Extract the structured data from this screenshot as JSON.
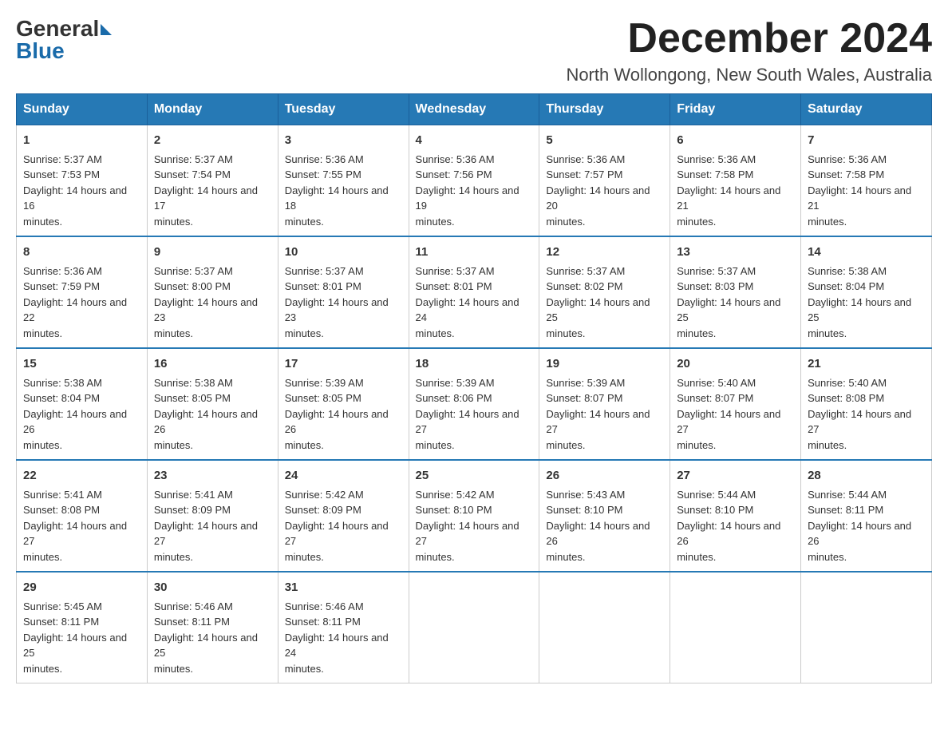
{
  "header": {
    "logo_general": "General",
    "logo_blue": "Blue",
    "month_title": "December 2024",
    "location": "North Wollongong, New South Wales, Australia"
  },
  "weekdays": [
    "Sunday",
    "Monday",
    "Tuesday",
    "Wednesday",
    "Thursday",
    "Friday",
    "Saturday"
  ],
  "weeks": [
    [
      {
        "day": "1",
        "sunrise": "5:37 AM",
        "sunset": "7:53 PM",
        "daylight": "14 hours and 16 minutes."
      },
      {
        "day": "2",
        "sunrise": "5:37 AM",
        "sunset": "7:54 PM",
        "daylight": "14 hours and 17 minutes."
      },
      {
        "day": "3",
        "sunrise": "5:36 AM",
        "sunset": "7:55 PM",
        "daylight": "14 hours and 18 minutes."
      },
      {
        "day": "4",
        "sunrise": "5:36 AM",
        "sunset": "7:56 PM",
        "daylight": "14 hours and 19 minutes."
      },
      {
        "day": "5",
        "sunrise": "5:36 AM",
        "sunset": "7:57 PM",
        "daylight": "14 hours and 20 minutes."
      },
      {
        "day": "6",
        "sunrise": "5:36 AM",
        "sunset": "7:58 PM",
        "daylight": "14 hours and 21 minutes."
      },
      {
        "day": "7",
        "sunrise": "5:36 AM",
        "sunset": "7:58 PM",
        "daylight": "14 hours and 21 minutes."
      }
    ],
    [
      {
        "day": "8",
        "sunrise": "5:36 AM",
        "sunset": "7:59 PM",
        "daylight": "14 hours and 22 minutes."
      },
      {
        "day": "9",
        "sunrise": "5:37 AM",
        "sunset": "8:00 PM",
        "daylight": "14 hours and 23 minutes."
      },
      {
        "day": "10",
        "sunrise": "5:37 AM",
        "sunset": "8:01 PM",
        "daylight": "14 hours and 23 minutes."
      },
      {
        "day": "11",
        "sunrise": "5:37 AM",
        "sunset": "8:01 PM",
        "daylight": "14 hours and 24 minutes."
      },
      {
        "day": "12",
        "sunrise": "5:37 AM",
        "sunset": "8:02 PM",
        "daylight": "14 hours and 25 minutes."
      },
      {
        "day": "13",
        "sunrise": "5:37 AM",
        "sunset": "8:03 PM",
        "daylight": "14 hours and 25 minutes."
      },
      {
        "day": "14",
        "sunrise": "5:38 AM",
        "sunset": "8:04 PM",
        "daylight": "14 hours and 25 minutes."
      }
    ],
    [
      {
        "day": "15",
        "sunrise": "5:38 AM",
        "sunset": "8:04 PM",
        "daylight": "14 hours and 26 minutes."
      },
      {
        "day": "16",
        "sunrise": "5:38 AM",
        "sunset": "8:05 PM",
        "daylight": "14 hours and 26 minutes."
      },
      {
        "day": "17",
        "sunrise": "5:39 AM",
        "sunset": "8:05 PM",
        "daylight": "14 hours and 26 minutes."
      },
      {
        "day": "18",
        "sunrise": "5:39 AM",
        "sunset": "8:06 PM",
        "daylight": "14 hours and 27 minutes."
      },
      {
        "day": "19",
        "sunrise": "5:39 AM",
        "sunset": "8:07 PM",
        "daylight": "14 hours and 27 minutes."
      },
      {
        "day": "20",
        "sunrise": "5:40 AM",
        "sunset": "8:07 PM",
        "daylight": "14 hours and 27 minutes."
      },
      {
        "day": "21",
        "sunrise": "5:40 AM",
        "sunset": "8:08 PM",
        "daylight": "14 hours and 27 minutes."
      }
    ],
    [
      {
        "day": "22",
        "sunrise": "5:41 AM",
        "sunset": "8:08 PM",
        "daylight": "14 hours and 27 minutes."
      },
      {
        "day": "23",
        "sunrise": "5:41 AM",
        "sunset": "8:09 PM",
        "daylight": "14 hours and 27 minutes."
      },
      {
        "day": "24",
        "sunrise": "5:42 AM",
        "sunset": "8:09 PM",
        "daylight": "14 hours and 27 minutes."
      },
      {
        "day": "25",
        "sunrise": "5:42 AM",
        "sunset": "8:10 PM",
        "daylight": "14 hours and 27 minutes."
      },
      {
        "day": "26",
        "sunrise": "5:43 AM",
        "sunset": "8:10 PM",
        "daylight": "14 hours and 26 minutes."
      },
      {
        "day": "27",
        "sunrise": "5:44 AM",
        "sunset": "8:10 PM",
        "daylight": "14 hours and 26 minutes."
      },
      {
        "day": "28",
        "sunrise": "5:44 AM",
        "sunset": "8:11 PM",
        "daylight": "14 hours and 26 minutes."
      }
    ],
    [
      {
        "day": "29",
        "sunrise": "5:45 AM",
        "sunset": "8:11 PM",
        "daylight": "14 hours and 25 minutes."
      },
      {
        "day": "30",
        "sunrise": "5:46 AM",
        "sunset": "8:11 PM",
        "daylight": "14 hours and 25 minutes."
      },
      {
        "day": "31",
        "sunrise": "5:46 AM",
        "sunset": "8:11 PM",
        "daylight": "14 hours and 24 minutes."
      },
      null,
      null,
      null,
      null
    ]
  ]
}
